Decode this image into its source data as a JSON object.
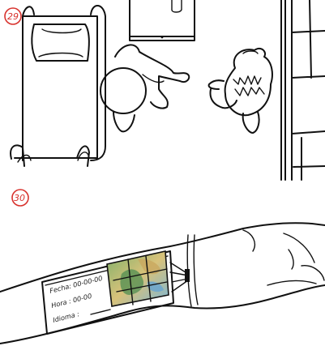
{
  "panels": [
    {
      "number": "29"
    },
    {
      "number": "30"
    }
  ],
  "screen": {
    "line1": "Fecha: 00-00-00",
    "line2": "Hora : 00-00",
    "line3": "Idioma :"
  },
  "colors": {
    "panel_number": "#d8322d",
    "ink": "#111111",
    "map_green": "#7fb06a",
    "map_sand": "#d8c27a",
    "map_blue": "#7ab6d8"
  }
}
